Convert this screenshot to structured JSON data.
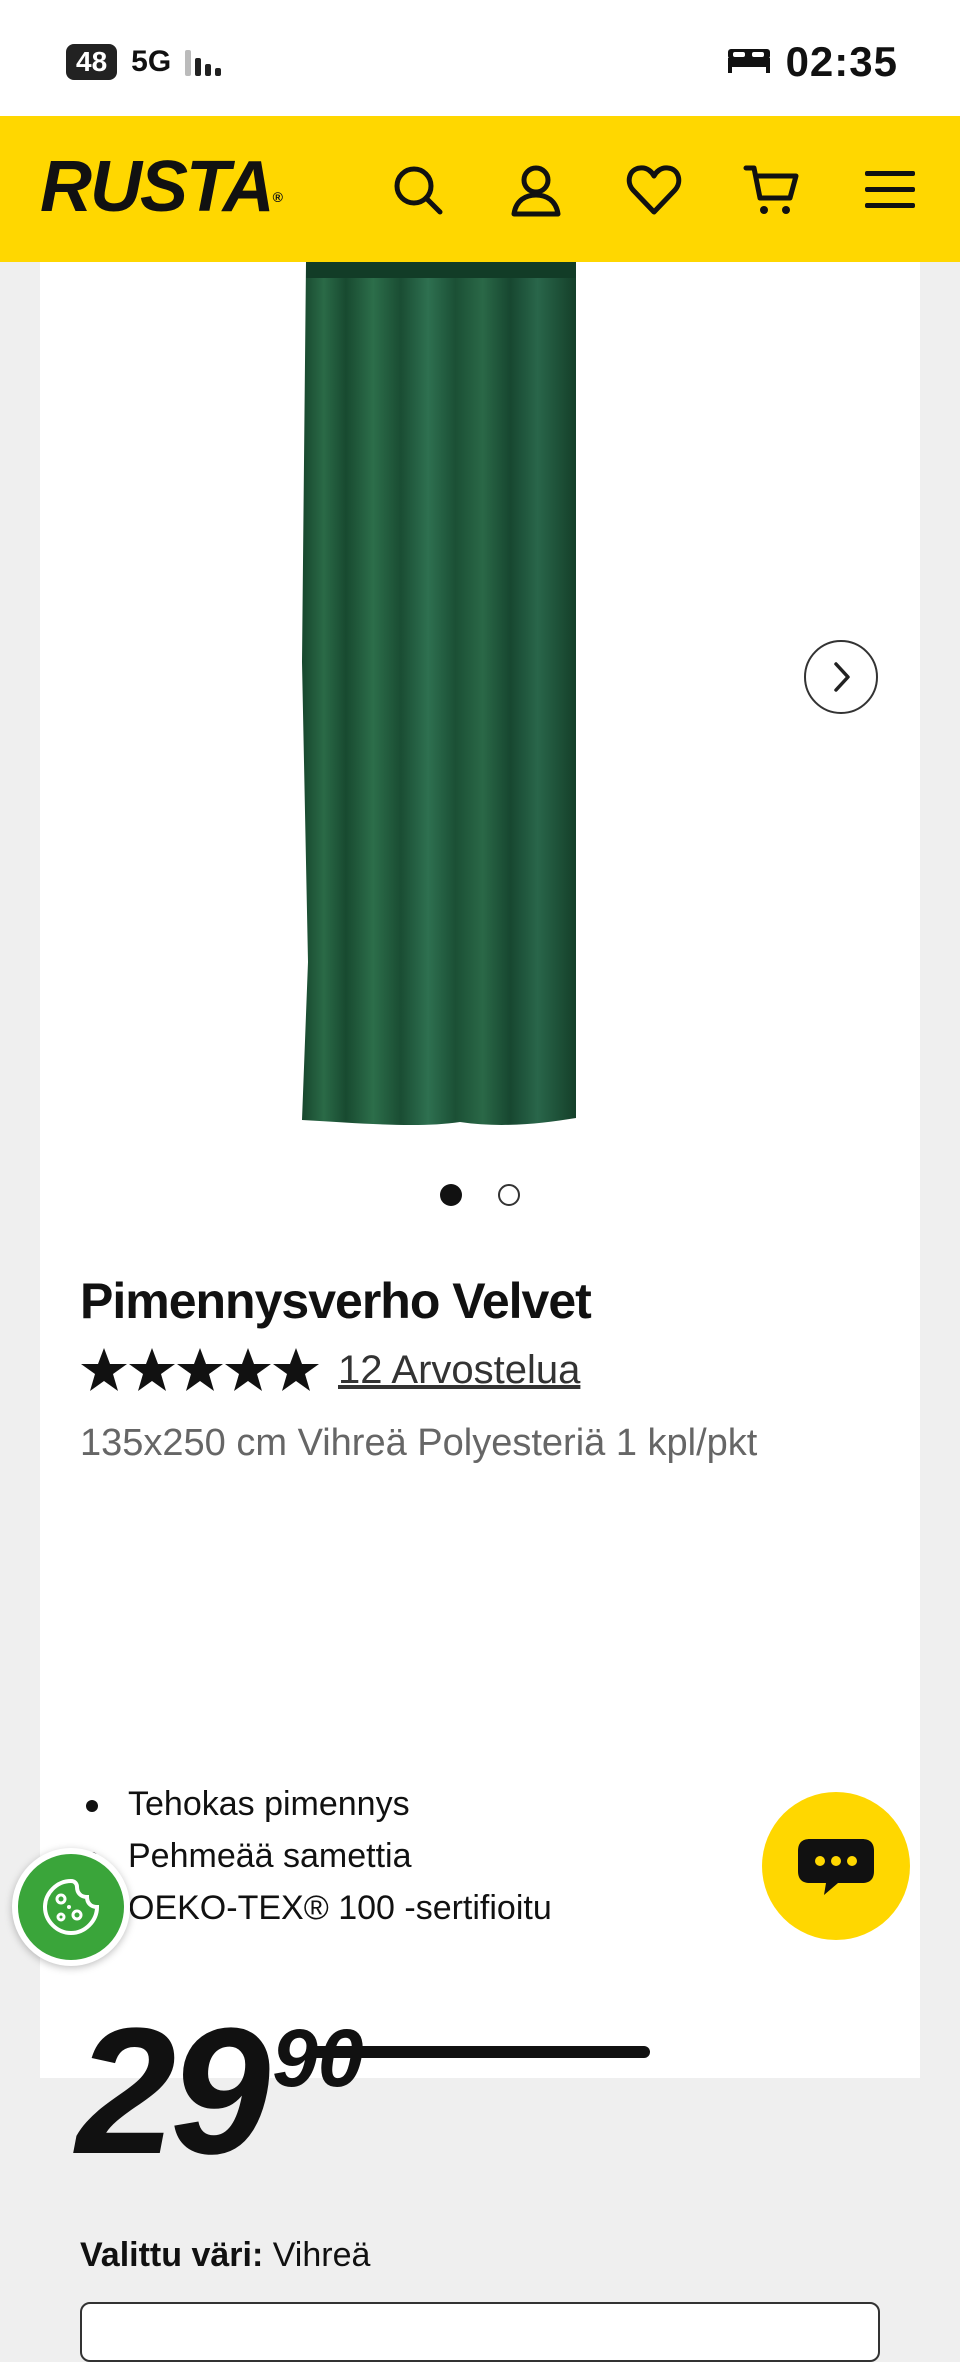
{
  "status_bar": {
    "battery": "48",
    "network": "5G",
    "time": "02:35",
    "icons": [
      "signal-icon",
      "bed-icon"
    ]
  },
  "header": {
    "logo": "RUSTA",
    "icons": [
      "search-icon",
      "account-icon",
      "heart-icon",
      "cart-icon",
      "menu-icon"
    ],
    "brand_color": "#ffd700"
  },
  "product": {
    "title": "Pimennysverho Velvet",
    "rating_stars": 5,
    "reviews": "12 Arvostelua",
    "subtitle": "135x250 cm Vihreä Polyesteriä 1 kpl/pkt",
    "features": [
      "Tehokas pimennys",
      "Pehmeää samettia",
      "OEKO-TEX® 100 -sertifioitu"
    ],
    "price_int": "29",
    "price_dec": "90",
    "color_label": "Valittu väri:",
    "color_value": "Vihreä",
    "image_count": 2,
    "image_active": 1,
    "curtain_color": "#1f5a3a"
  },
  "floating": {
    "chat_icon": "chat-icon",
    "cookie_icon": "cookie-icon",
    "chat_color": "#ffd700",
    "cookie_color": "#3aa53a"
  }
}
